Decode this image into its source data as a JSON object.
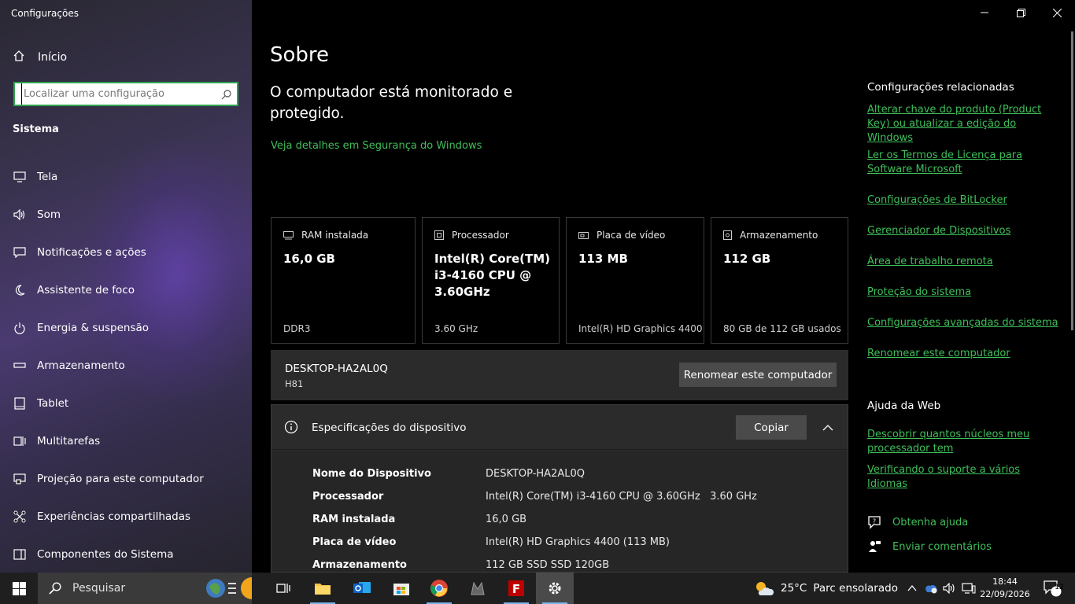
{
  "window": {
    "title": "Configurações"
  },
  "sidebar": {
    "home_label": "Início",
    "search_placeholder": "Localizar uma configuração",
    "section_title": "Sistema",
    "items": [
      {
        "label": "Tela",
        "icon": "monitor-icon"
      },
      {
        "label": "Som",
        "icon": "speaker-icon"
      },
      {
        "label": "Notificações e ações",
        "icon": "message-icon"
      },
      {
        "label": "Assistente de foco",
        "icon": "moon-icon"
      },
      {
        "label": "Energia & suspensão",
        "icon": "power-icon"
      },
      {
        "label": "Armazenamento",
        "icon": "drive-icon"
      },
      {
        "label": "Tablet",
        "icon": "tablet-icon"
      },
      {
        "label": "Multitarefas",
        "icon": "multitask-icon"
      },
      {
        "label": "Projeção para este computador",
        "icon": "projection-icon"
      },
      {
        "label": "Experiências compartilhadas",
        "icon": "share-icon"
      },
      {
        "label": "Componentes do Sistema",
        "icon": "components-icon"
      }
    ]
  },
  "main": {
    "title": "Sobre",
    "protection_text": "O computador está monitorado e protegido.",
    "security_link": "Veja detalhes em Segurança do Windows",
    "cards": [
      {
        "label": "RAM instalada",
        "value": "16,0 GB",
        "sub": "DDR3",
        "icon": "ram-icon"
      },
      {
        "label": "Processador",
        "value": "Intel(R) Core(TM) i3-4160 CPU @ 3.60GHz",
        "sub": "3.60 GHz",
        "icon": "cpu-icon"
      },
      {
        "label": "Placa de vídeo",
        "value": "113 MB",
        "sub": "Intel(R) HD Graphics 4400",
        "icon": "gpu-icon"
      },
      {
        "label": "Armazenamento",
        "value": "112 GB",
        "sub": "80 GB de 112 GB usados",
        "icon": "storage-icon"
      }
    ],
    "device": {
      "name": "DESKTOP-HA2AL0Q",
      "model": "H81",
      "rename_label": "Renomear este computador"
    },
    "specs": {
      "title": "Especificações do dispositivo",
      "copy_label": "Copiar",
      "rows": [
        {
          "key": "Nome do Dispositivo",
          "value": "DESKTOP-HA2AL0Q"
        },
        {
          "key": "Processador",
          "value": "Intel(R) Core(TM) i3-4160 CPU @ 3.60GHz   3.60 GHz"
        },
        {
          "key": "RAM instalada",
          "value": "16,0 GB"
        },
        {
          "key": "Placa de vídeo",
          "value": "Intel(R) HD Graphics 4400 (113 MB)"
        },
        {
          "key": "Armazenamento",
          "value": "112 GB SSD SSD 120GB"
        }
      ]
    }
  },
  "related": {
    "title": "Configurações relacionadas",
    "links": [
      "Alterar chave do produto (Product Key) ou atualizar a edição do Windows",
      "Ler os Termos de Licença para Software Microsoft",
      "Configurações de BitLocker",
      "Gerenciador de Dispositivos",
      "Área de trabalho remota",
      "Proteção do sistema",
      "Configurações avançadas do sistema",
      "Renomear este computador"
    ]
  },
  "web_help": {
    "title": "Ajuda da Web",
    "links": [
      "Descobrir quantos núcleos meu processador tem",
      "Verificando o suporte a vários Idiomas"
    ]
  },
  "help": {
    "get_help": "Obtenha ajuda",
    "feedback": "Enviar comentários"
  },
  "taskbar": {
    "search_label": "Pesquisar",
    "weather_temp": "25°C",
    "weather_desc": "Parc ensolarado",
    "time": "18:44",
    "date": "22/09/2026",
    "notification_count": "12"
  },
  "colors": {
    "accent_green": "#3fbf5a",
    "sidebar_purple": "#4a3a70"
  }
}
